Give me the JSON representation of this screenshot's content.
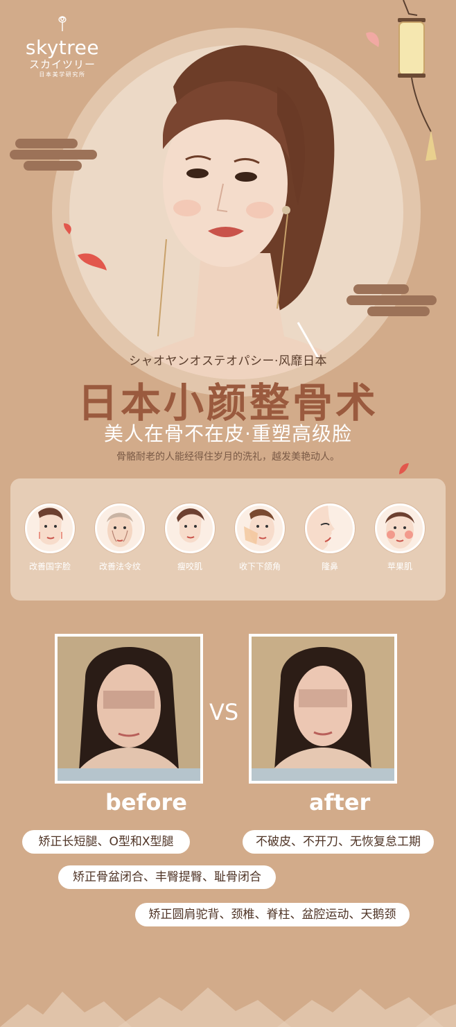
{
  "brand": {
    "name": "skytree",
    "kana": "スカイツリー",
    "sub": "日本美学研究所"
  },
  "hero": {
    "tagline_jp": "シャオヤンオステオパシー·风靡日本",
    "headline": "日本小颜整骨术",
    "subhead": "美人在骨不在皮·重塑高级脸",
    "description": "骨骼耐老的人能经得住岁月的洗礼，越发美艳动人。"
  },
  "features": [
    {
      "label": "改善国字脸",
      "icon": "square-face-icon"
    },
    {
      "label": "改善法令纹",
      "icon": "nasolabial-fold-icon"
    },
    {
      "label": "瘦咬肌",
      "icon": "slim-masseter-icon"
    },
    {
      "label": "收下下颌角",
      "icon": "jaw-angle-icon"
    },
    {
      "label": "隆鼻",
      "icon": "nose-profile-icon"
    },
    {
      "label": "苹果肌",
      "icon": "apple-cheek-icon"
    }
  ],
  "comparison": {
    "vs": "VS",
    "before": "before",
    "after": "after"
  },
  "benefits": [
    "矫正长短腿、O型和X型腿",
    "不破皮、不开刀、无恢复怠工期",
    "矫正骨盆闭合、丰臀提臀、耻骨闭合",
    "矫正圆肩驼背、颈椎、脊柱、盆腔运动、天鹅颈"
  ],
  "colors": {
    "background": "#d2ab8a",
    "headline": "#9a5a3e",
    "panel": "#e6cdb6"
  }
}
